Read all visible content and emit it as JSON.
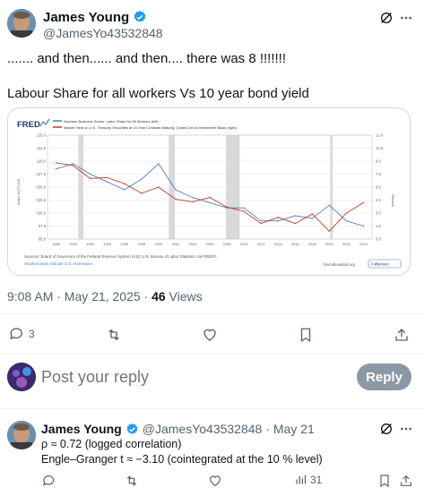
{
  "tweet": {
    "author_name": "James Young",
    "author_handle": "@JamesYo43532848",
    "line1": "....... and then...... and then.... there was 8 !!!!!!!",
    "line2": "Labour Share for all workers  Vs 10 year bond yield",
    "time": "9:08 AM · May 21, 2025 · ",
    "views_count": "46",
    "views_label": " Views",
    "reply_count": "3"
  },
  "chart": {
    "brand": "FRED",
    "legend1": "Nonfarm Business Sector: Labor Share for All Workers (left)",
    "legend2": "Market Yield on U.S. Treasury Securities at 10-Year Constant Maturity, Quoted on an Investment Basis (right)",
    "left_axis_title": "Index 2017=100",
    "right_axis_title": "Percent",
    "left_ticks": [
      "115.0",
      "112.5",
      "110.0",
      "107.5",
      "105.0",
      "102.5",
      "100.0",
      "97.5",
      "95.0"
    ],
    "right_ticks": [
      "12.0",
      "10.5",
      "9.0",
      "7.5",
      "6.0",
      "4.5",
      "3.0",
      "1.5",
      "0.0"
    ],
    "x_ticks": [
      "1988",
      "1990",
      "1992",
      "1994",
      "1996",
      "1998",
      "2000",
      "2002",
      "2004",
      "2006",
      "2008",
      "2010",
      "2012",
      "2014",
      "2016",
      "2018",
      "2020",
      "2022",
      "2024"
    ],
    "sources": "Sources: Board of Governors of the Federal Reserve System (US); U.S. Bureau of Labor Statistics via FRED®",
    "shaded_note": "Shaded areas indicate U.S. recessions.",
    "url": "fred.stlouisfed.org",
    "fullscreen": "Fullscreen"
  },
  "reply_box": {
    "placeholder": "Post your reply",
    "button": "Reply"
  },
  "reply_tweet": {
    "author_name": "James Young",
    "author_handle": "@JamesYo43532848",
    "date": "· May 21",
    "line1": "ρ ≈ 0.72 (logged correlation)",
    "line2": "Engle–Granger t ≈ −3.10 (cointegrated at the 10 % level)",
    "views": "31"
  },
  "colors": {
    "labor_share": "#4a7ec9",
    "bond_yield": "#c0392b",
    "verified": "#1d9bf0",
    "recession": "#d9d9d9"
  },
  "chart_data": {
    "type": "line",
    "x": [
      "1988",
      "1990",
      "1992",
      "1994",
      "1996",
      "1998",
      "2000",
      "2002",
      "2004",
      "2006",
      "2008",
      "2010",
      "2012",
      "2014",
      "2016",
      "2018",
      "2020",
      "2022",
      "2024"
    ],
    "series": [
      {
        "name": "Nonfarm Business Sector: Labor Share for All Workers (left)",
        "axis": "left",
        "values": [
          108.5,
          109.5,
          107.5,
          106.0,
          104.5,
          106.5,
          109.5,
          104.5,
          103.0,
          102.0,
          101.0,
          101.0,
          98.5,
          98.5,
          99.5,
          99.0,
          101.5,
          98.5,
          97.5
        ]
      },
      {
        "name": "Market Yield on U.S. Treasury Securities at 10-Year Constant Maturity, Quoted on an Investment Basis (right)",
        "axis": "right",
        "values": [
          8.8,
          8.5,
          7.0,
          7.1,
          6.4,
          5.3,
          6.0,
          4.6,
          4.3,
          4.8,
          3.7,
          3.2,
          1.8,
          2.5,
          1.8,
          2.9,
          0.9,
          3.0,
          4.2
        ]
      }
    ],
    "ylim_left": [
      95.0,
      115.0
    ],
    "ylim_right": [
      0.0,
      12.0
    ],
    "recessions": [
      [
        "1990.6",
        "1991.2"
      ],
      [
        "2001.2",
        "2001.9"
      ],
      [
        "2007.9",
        "2009.5"
      ],
      [
        "2020.1",
        "2020.4"
      ]
    ]
  }
}
